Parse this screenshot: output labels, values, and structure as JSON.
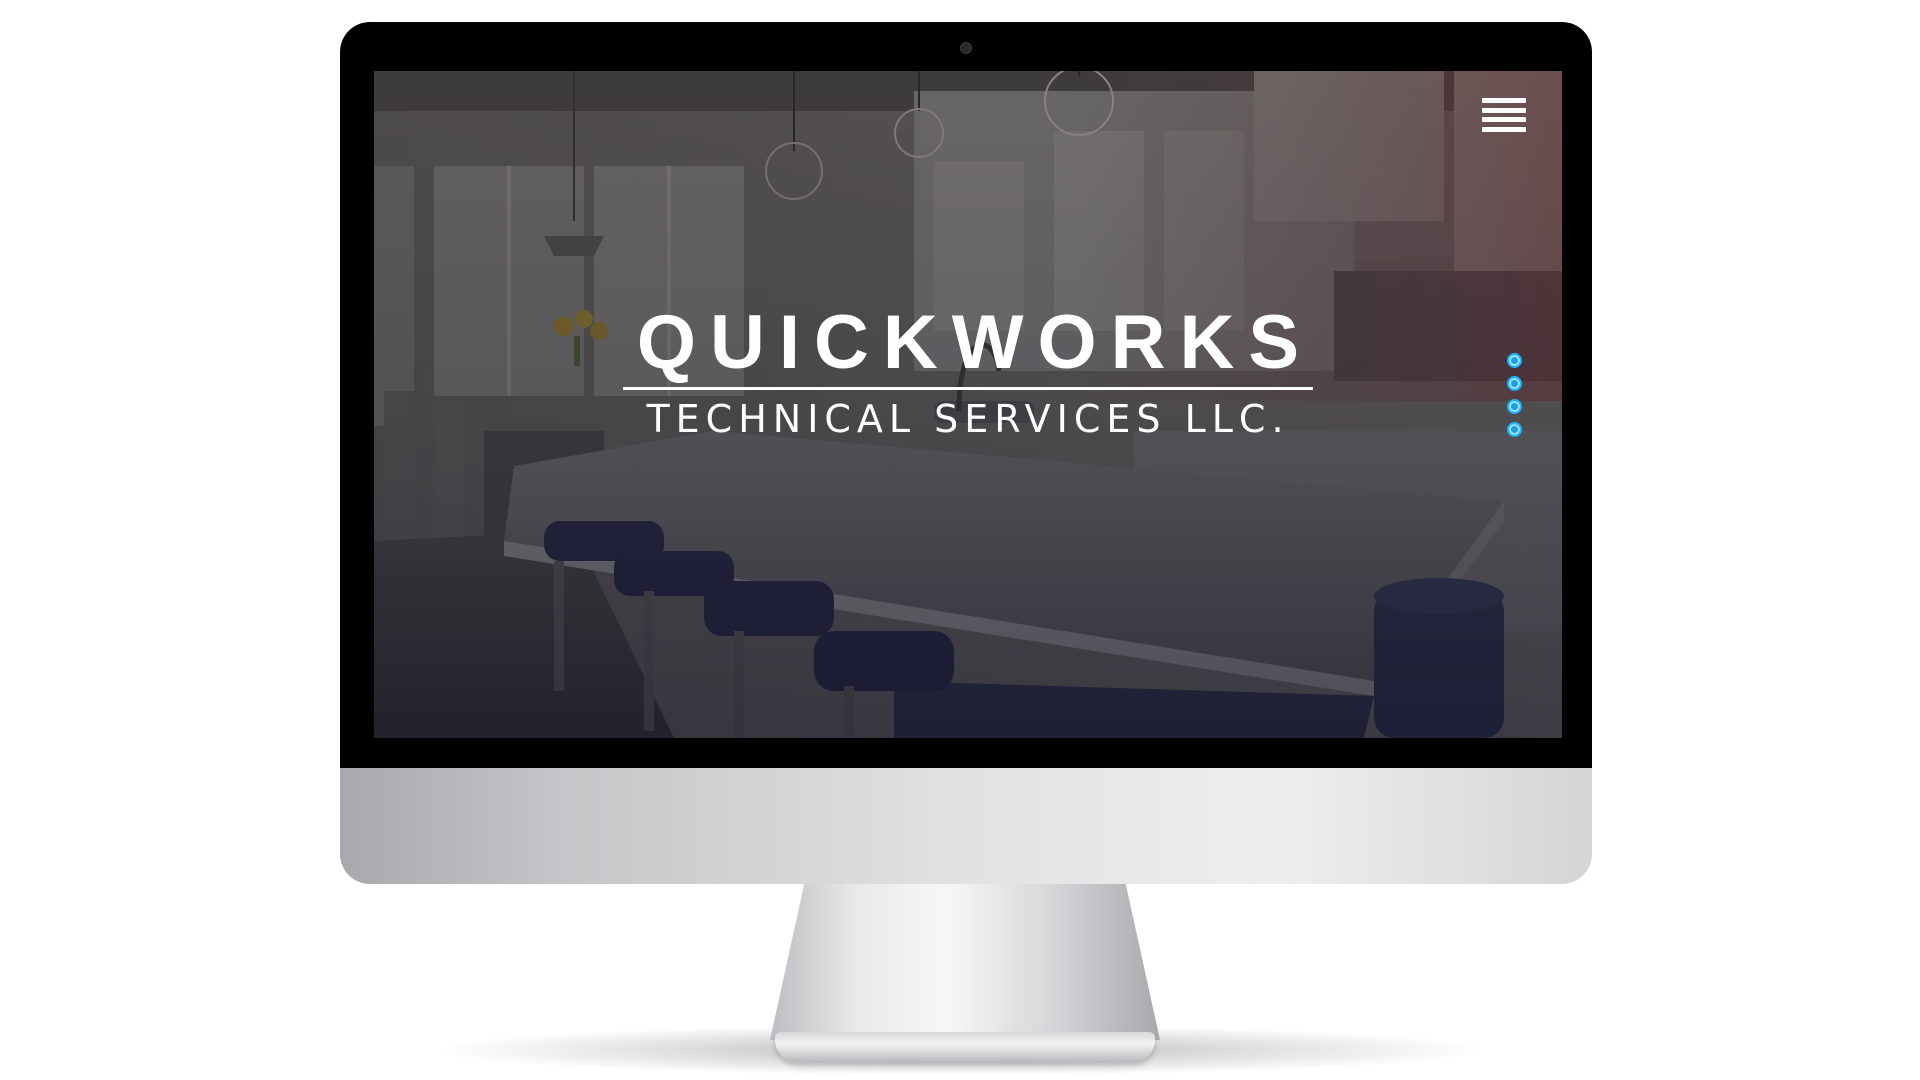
{
  "site": {
    "title": "QUICKWORKS",
    "subtitle": "TECHNICAL SERVICES LLC."
  },
  "navigation": {
    "menu_icon": "hamburger-menu-icon"
  },
  "slider": {
    "dot_count": 4,
    "dot_color": "#1aa1e6"
  },
  "hero": {
    "background": "kitchen interior photo with dark overlay"
  },
  "colors": {
    "text": "#ffffff",
    "accent": "#1aa1e6",
    "bezel": "#000000"
  }
}
